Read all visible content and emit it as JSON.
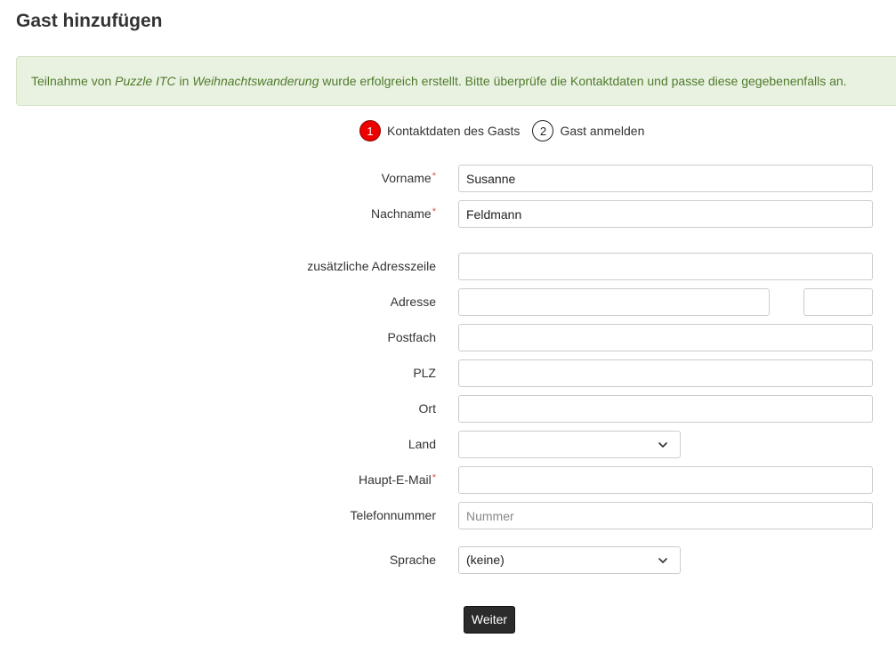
{
  "page": {
    "title": "Gast hinzufügen"
  },
  "alert": {
    "prefix": "Teilnahme von ",
    "person": "Puzzle ITC",
    "middle": " in ",
    "event": "Weihnachtswanderung",
    "suffix": " wurde erfolgreich erstellt. Bitte überprüfe die Kontaktdaten und passe diese gegebenenfalls an."
  },
  "steps": [
    {
      "number": "1",
      "label": "Kontaktdaten des Gasts",
      "active": true
    },
    {
      "number": "2",
      "label": "Gast anmelden",
      "active": false
    }
  ],
  "form": {
    "first_name": {
      "label": "Vorname",
      "value": "Susanne",
      "required": "*"
    },
    "last_name": {
      "label": "Nachname",
      "value": "Feldmann",
      "required": "*"
    },
    "address_care_of": {
      "label": "zusätzliche Adresszeile",
      "value": ""
    },
    "address": {
      "label": "Adresse",
      "street_value": "",
      "housenumber_value": ""
    },
    "postbox": {
      "label": "Postfach",
      "value": ""
    },
    "zip_code": {
      "label": "PLZ",
      "value": ""
    },
    "town": {
      "label": "Ort",
      "value": ""
    },
    "country": {
      "label": "Land",
      "selected": ""
    },
    "email": {
      "label": "Haupt-E-Mail",
      "value": "",
      "required": "*"
    },
    "phone": {
      "label": "Telefonnummer",
      "value": "",
      "placeholder": "Nummer"
    },
    "language": {
      "label": "Sprache",
      "selected": "(keine)"
    },
    "submit_label": "Weiter"
  },
  "icons": {
    "select_chevron": "chevron-down-icon"
  },
  "colors": {
    "alert_background": "#e9f2e1",
    "alert_text": "#4f7a2b",
    "active_step": "#ee0000",
    "required": "#d9534f",
    "button": "#2b2b2b"
  }
}
